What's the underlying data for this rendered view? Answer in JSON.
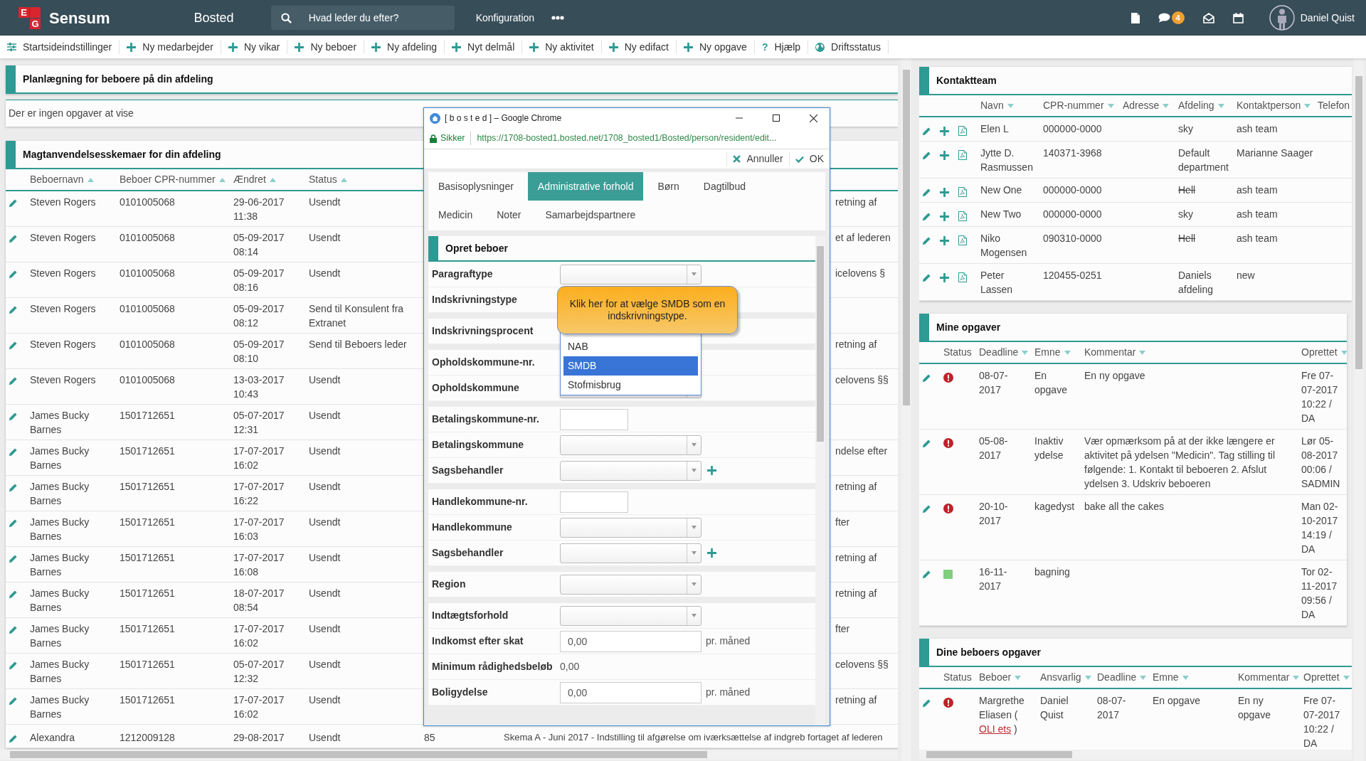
{
  "navbar": {
    "logo_letters": [
      "E",
      "G"
    ],
    "brand": "Sensum",
    "module": "Bosted",
    "search": {
      "placeholder": "Hvad leder du efter?"
    },
    "menu": "Konfiguration",
    "notifications": "4",
    "user": "Daniel Quist"
  },
  "toolbar": [
    {
      "kind": "settings",
      "label": "Startsideindstillinger"
    },
    {
      "kind": "add",
      "label": "Ny medarbejder"
    },
    {
      "kind": "add",
      "label": "Ny vikar"
    },
    {
      "kind": "add",
      "label": "Ny beboer"
    },
    {
      "kind": "add",
      "label": "Ny afdeling"
    },
    {
      "kind": "add",
      "label": "Nyt delmål"
    },
    {
      "kind": "add",
      "label": "Ny aktivitet"
    },
    {
      "kind": "add",
      "label": "Ny edifact"
    },
    {
      "kind": "add",
      "label": "Ny opgave"
    },
    {
      "kind": "help",
      "glyph": "?",
      "label": "Hjælp"
    },
    {
      "kind": "globe",
      "label": "Driftsstatus"
    }
  ],
  "planning": {
    "title": "Planlægning for beboere på din afdeling",
    "empty": "Der er ingen opgaver at vise"
  },
  "forms_panel": {
    "title": "Magtanvendelsesskemaer for din afdeling",
    "columns": [
      {
        "label": "Beboernavn",
        "kind": "sort_asc"
      },
      {
        "label": "Beboer CPR-nummer",
        "kind": "sort_asc"
      },
      {
        "label": "Ændret",
        "kind": "sort_asc"
      },
      {
        "label": "Status",
        "kind": "sort_asc"
      }
    ],
    "rows": [
      {
        "name": "Steven Rogers",
        "cpr": "0101005068",
        "changed": "29-06-2017 11:38",
        "status": "Usendt",
        "column_6_tail": "retning af"
      },
      {
        "name": "Steven Rogers",
        "cpr": "0101005068",
        "changed": "05-09-2017 08:14",
        "status": "Usendt",
        "column_6_tail": "et af lederen"
      },
      {
        "name": "Steven Rogers",
        "cpr": "0101005068",
        "changed": "05-09-2017 08:16",
        "status": "Usendt",
        "column_6_tail": "icelovens §"
      },
      {
        "name": "Steven Rogers",
        "cpr": "0101005068",
        "changed": "05-09-2017 08:12",
        "status": "Send til Konsulent fra Extranet"
      },
      {
        "name": "Steven Rogers",
        "cpr": "0101005068",
        "changed": "05-09-2017 08:10",
        "status": "Send til Beboers leder",
        "column_6_tail": "retning af"
      },
      {
        "name": "Steven Rogers",
        "cpr": "0101005068",
        "changed": "13-03-2017 10:43",
        "status": "Usendt",
        "column_6_tail": "celovens §§"
      },
      {
        "name": "James Bucky Barnes",
        "cpr": "1501712651",
        "changed": "05-07-2017 12:31",
        "status": "Usendt"
      },
      {
        "name": "James Bucky Barnes",
        "cpr": "1501712651",
        "changed": "17-07-2017 16:02",
        "status": "Usendt",
        "column_6_tail": "ndelse efter"
      },
      {
        "name": "James Bucky Barnes",
        "cpr": "1501712651",
        "changed": "17-07-2017 16:22",
        "status": "Usendt",
        "column_6_tail": "retning af"
      },
      {
        "name": "James Bucky Barnes",
        "cpr": "1501712651",
        "changed": "17-07-2017 16:03",
        "status": "Usendt",
        "column_6_tail": "fter"
      },
      {
        "name": "James Bucky Barnes",
        "cpr": "1501712651",
        "changed": "17-07-2017 16:08",
        "status": "Usendt",
        "column_6_tail": "retning af"
      },
      {
        "name": "James Bucky Barnes",
        "cpr": "1501712651",
        "changed": "18-07-2017 08:54",
        "status": "Usendt",
        "column_6_tail": "retning af"
      },
      {
        "name": "James Bucky Barnes",
        "cpr": "1501712651",
        "changed": "17-07-2017 16:02",
        "status": "Usendt",
        "column_6_tail": "fter"
      },
      {
        "name": "James Bucky Barnes",
        "cpr": "1501712651",
        "changed": "05-07-2017 12:32",
        "status": "Usendt",
        "column_6_tail": "celovens §§"
      },
      {
        "name": "James Bucky Barnes",
        "cpr": "1501712651",
        "changed": "17-07-2017 16:02",
        "status": "Usendt",
        "column_6_tail": "retning af"
      },
      {
        "name": "Alexandra",
        "cpr": "1212009128",
        "changed": "29-08-2017",
        "status": "Usendt",
        "column_5": "85",
        "column_6": "Skema A - Juni 2017 - Indstilling til afgørelse om iværksættelse af indgreb fortaget af lederen"
      }
    ]
  },
  "dialog": {
    "title": "[ b o s t e d ] – Google Chrome",
    "security": "Sikker",
    "url": "https://1708-bosted1.bosted.net/1708_bosted1/Bosted/person/resident/edit...",
    "actions": [
      {
        "kind": "cancel",
        "label": "Annuller"
      },
      {
        "kind": "ok",
        "label": "OK"
      }
    ],
    "tabs": [
      [
        {
          "label": "Basisoplysninger",
          "selected": false
        },
        {
          "label": "Administrative forhold",
          "selected": true
        },
        {
          "label": "Børn",
          "selected": false
        },
        {
          "label": "Dagtilbud",
          "selected": false
        }
      ],
      [
        {
          "label": "Medicin",
          "selected": false
        },
        {
          "label": "Noter",
          "selected": false
        },
        {
          "label": "Samarbejdspartnere",
          "selected": false
        }
      ]
    ],
    "form": {
      "title": "Opret beboer",
      "groups": [
        {
          "fields": [
            {
              "label": "Paragraftype",
              "kind": "select"
            },
            {
              "label": "Indskrivningstype",
              "kind": "covered",
              "tooltip": "Klik her for at vælge SMDB som en indskrivningstype.",
              "dropdown": [
                {
                  "label": "NAB",
                  "selected": false
                },
                {
                  "label": "SMDB",
                  "selected": true
                },
                {
                  "label": "Stofmisbrug",
                  "selected": false
                }
              ]
            }
          ]
        },
        {
          "fields": [
            {
              "label": "Indskrivningsprocent",
              "kind": "covered"
            }
          ]
        },
        {
          "fields": [
            {
              "label": "Opholdskommune-nr.",
              "kind": "covered"
            },
            {
              "label": "Opholdskommune",
              "kind": "select"
            }
          ]
        },
        {
          "fields": [
            {
              "label": "Betalingskommune-nr.",
              "kind": "short"
            },
            {
              "label": "Betalingskommune",
              "kind": "select"
            },
            {
              "label": "Sagsbehandler",
              "kind": "select_add"
            }
          ]
        },
        {
          "fields": [
            {
              "label": "Handlekommune-nr.",
              "kind": "short"
            },
            {
              "label": "Handlekommune",
              "kind": "select"
            },
            {
              "label": "Sagsbehandler",
              "kind": "select_add"
            }
          ]
        },
        {
          "fields": [
            {
              "label": "Region",
              "kind": "select"
            }
          ]
        },
        {
          "fields": [
            {
              "label": "Indtægtsforhold",
              "kind": "select"
            },
            {
              "label": "Indkomst efter skat",
              "kind": "amount",
              "value": "0,00",
              "suffix": "pr. måned"
            },
            {
              "label": "Minimum rådighedsbeløb",
              "kind": "static",
              "value": "0,00"
            },
            {
              "label": "Boligydelse",
              "kind": "amount",
              "value": "0,00",
              "suffix": "pr. måned"
            }
          ]
        }
      ]
    }
  },
  "contact_team": {
    "title": "Kontaktteam",
    "columns": [
      {
        "label": "Navn",
        "kind": "sort_desc"
      },
      {
        "label": "CPR-nummer",
        "kind": "sort_desc"
      },
      {
        "label": "Adresse",
        "kind": "sort_desc"
      },
      {
        "label": "Afdeling",
        "kind": "sort_desc"
      },
      {
        "label": "Kontaktperson",
        "kind": "sort_desc"
      },
      {
        "label": "Telefon",
        "kind": "plain"
      }
    ],
    "rows": [
      {
        "name": "Elen L",
        "cpr": "000000-0000",
        "department": "sky",
        "department_struck": false,
        "contact": "ash team"
      },
      {
        "name": "Jytte D. Rasmussen",
        "cpr": "140371-3968",
        "department": "Default department",
        "department_struck": false,
        "contact": "Marianne Saager"
      },
      {
        "name": "New One",
        "cpr": "000000-0000",
        "department": "Hell",
        "department_struck": true,
        "contact": "ash team"
      },
      {
        "name": "New Two",
        "cpr": "000000-0000",
        "department": "sky",
        "department_struck": false,
        "contact": "ash team"
      },
      {
        "name": "Niko Mogensen",
        "cpr": "090310-0000",
        "department": "Hell",
        "department_struck": true,
        "contact": "ash team"
      },
      {
        "name": "Peter Lassen",
        "cpr": "120455-0251",
        "department": "Daniels afdeling",
        "department_struck": false,
        "contact": "new"
      }
    ]
  },
  "my_tasks": {
    "title": "Mine opgaver",
    "columns": [
      {
        "label": "Status",
        "kind": "plain"
      },
      {
        "label": "Deadline",
        "kind": "sort_desc"
      },
      {
        "label": "Emne",
        "kind": "sort_desc"
      },
      {
        "label": "Kommentar",
        "kind": "sort_desc"
      },
      {
        "label": "Oprettet",
        "kind": "sort_desc"
      }
    ],
    "rows": [
      {
        "kind": "alert",
        "deadline": "08-07-2017",
        "subject": "En opgave",
        "comment": "En ny opgave",
        "created": "Fre 07-07-2017 10:22 / DA"
      },
      {
        "kind": "alert",
        "deadline": "05-08-2017",
        "subject": "Inaktiv ydelse",
        "comment": "Vær opmærksom på at der ikke længere er aktivitet på ydelsen \"Medicin\". Tag stilling til følgende: 1. Kontakt til beboeren 2. Afslut ydelsen 3. Udskriv beboeren",
        "created": "Lør 05-08-2017 00:06 / SADMIN"
      },
      {
        "kind": "alert",
        "deadline": "20-10-2017",
        "subject": "kagedyst",
        "comment": "bake all the cakes",
        "created": "Man 02-10-2017 14:19 / DA"
      },
      {
        "kind": "ok",
        "deadline": "16-11-2017",
        "subject": "bagning",
        "created": "Tor 02-11-2017 09:56 / DA"
      }
    ]
  },
  "resident_tasks": {
    "title": "Dine beboers opgaver",
    "columns": [
      {
        "label": "Status",
        "kind": "plain"
      },
      {
        "label": "Beboer",
        "kind": "sort_desc"
      },
      {
        "label": "Ansvarlig",
        "kind": "sort_desc"
      },
      {
        "label": "Deadline",
        "kind": "sort_desc"
      },
      {
        "label": "Emne",
        "kind": "sort_desc"
      },
      {
        "label": "Kommentar",
        "kind": "sort_desc"
      },
      {
        "label": "Oprettet",
        "kind": "sort_desc"
      }
    ],
    "rows": [
      {
        "kind": "alert",
        "resident": "Margrethe Eliasen (",
        "resident_link": "OLI ets",
        "resident_end": ")",
        "responsible": "Daniel Quist",
        "deadline": "08-07-2017",
        "subject": "En opgave",
        "comment": "En ny opgave",
        "created": "Fre 07-07-2017 10:22 / DA"
      }
    ]
  }
}
